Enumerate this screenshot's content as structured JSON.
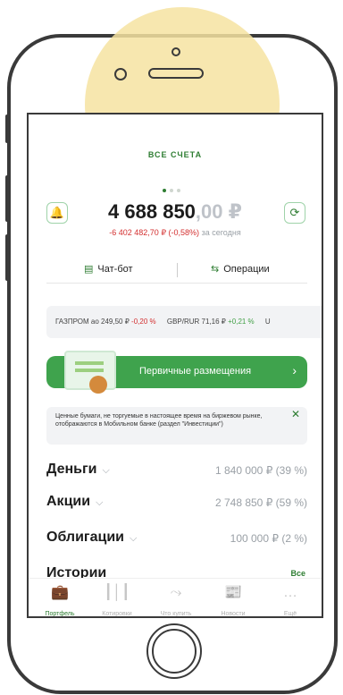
{
  "header": {
    "account_label": "ВСЕ СЧЕТА"
  },
  "balance": {
    "whole": "4 688 850",
    "decimals": ",00 ₽",
    "change_value": "-6 402 482,70 ₽ (-0,58%)",
    "change_suffix": "за сегодня"
  },
  "actions": {
    "chatbot": "Чат-бот",
    "operations": "Операции"
  },
  "ticker": [
    {
      "name": "ГАЗПРОМ ао 249,50 ₽",
      "change": "-0,20 %",
      "dir": "down"
    },
    {
      "name": "GBP/RUR 71,16 ₽",
      "change": "+0,21 %",
      "dir": "up"
    },
    {
      "name": "U",
      "change": "",
      "dir": "none"
    }
  ],
  "banner": {
    "label": "Первичные размещения"
  },
  "notice": {
    "text": "Ценные бумаги, не торгуемые в настоящее время на биржевом рынке, отображаются в Мобильном банке (раздел \"Инвестиции\")"
  },
  "portfolio": [
    {
      "label": "Деньги",
      "value": "1 840 000 ₽ (39 %)"
    },
    {
      "label": "Акции",
      "value": "2 748 850 ₽ (59 %)"
    },
    {
      "label": "Облигации",
      "value": "100 000 ₽ (2 %)"
    }
  ],
  "stories": {
    "title": "Истории",
    "all": "Все"
  },
  "tabs": [
    {
      "label": "Портфель",
      "icon": "briefcase-icon"
    },
    {
      "label": "Котировки",
      "icon": "candles-icon"
    },
    {
      "label": "Что купить",
      "icon": "trend-icon"
    },
    {
      "label": "Новости",
      "icon": "news-icon"
    },
    {
      "label": "Ещё",
      "icon": "more-icon"
    }
  ],
  "colors": {
    "brand_green": "#2e7d32",
    "negative": "#d32f2f",
    "positive": "#43a047"
  }
}
